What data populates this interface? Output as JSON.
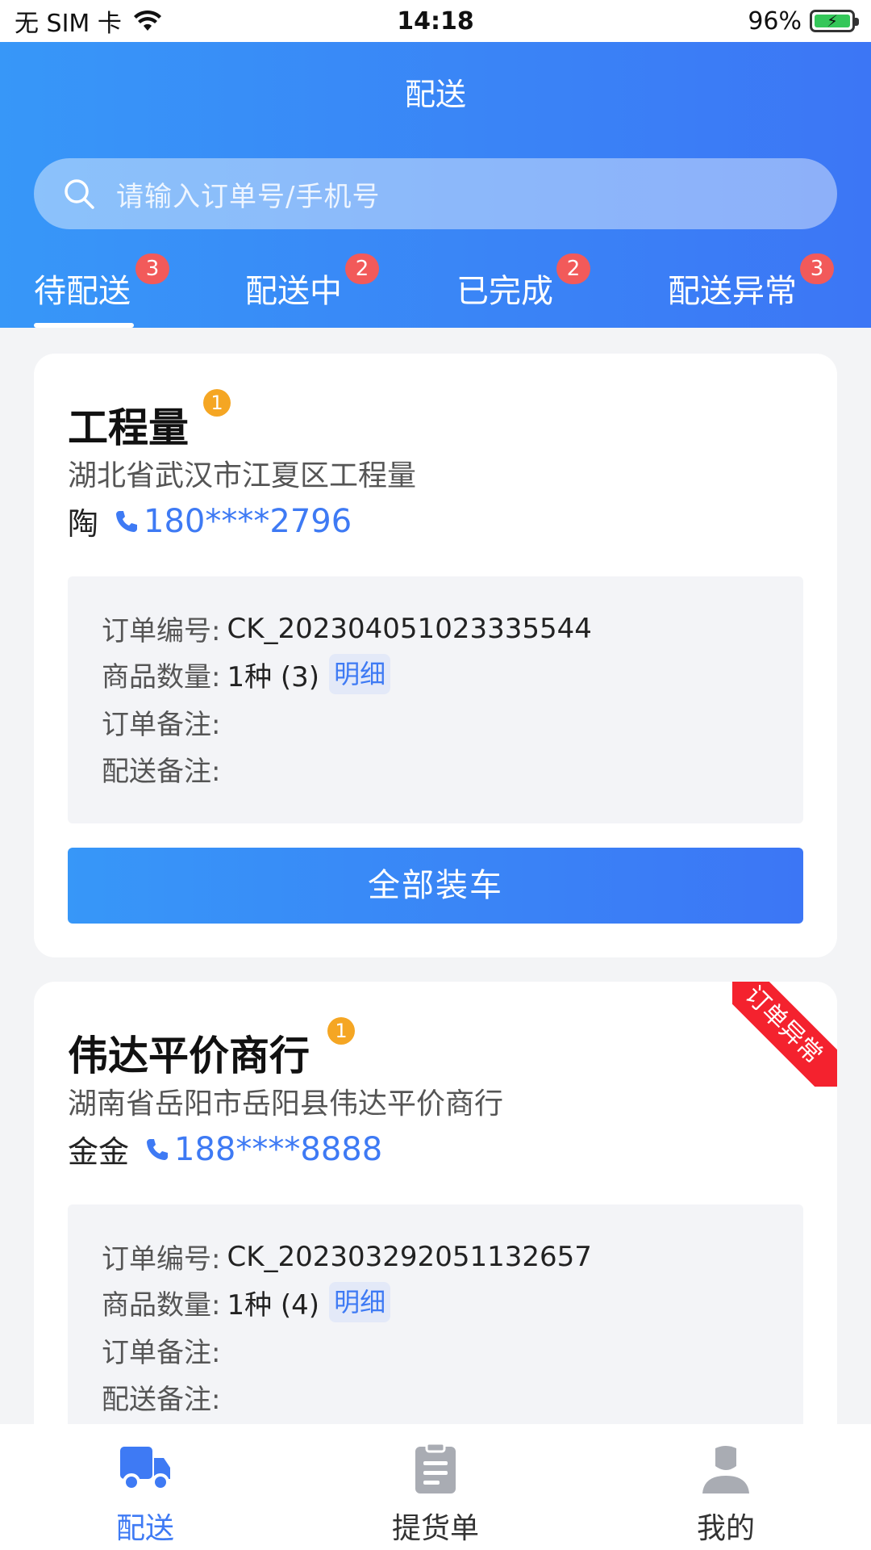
{
  "status_bar": {
    "carrier": "无 SIM 卡",
    "time": "14:18",
    "battery": "96%"
  },
  "header": {
    "title": "配送",
    "search_placeholder": "请输入订单号/手机号"
  },
  "tabs": [
    {
      "label": "待配送",
      "badge": "3"
    },
    {
      "label": "配送中",
      "badge": "2"
    },
    {
      "label": "已完成",
      "badge": "2"
    },
    {
      "label": "配送异常",
      "badge": "3"
    }
  ],
  "orders": [
    {
      "name": "工程量",
      "badge": "1",
      "address": "湖北省武汉市江夏区工程量",
      "contact_name": "陶",
      "phone": "180****2796",
      "order_no_label": "订单编号:",
      "order_no": "CK_202304051023335544",
      "qty_label": "商品数量:",
      "qty": "1种 (3)",
      "detail_label": "明细",
      "order_note_label": "订单备注:",
      "delivery_note_label": "配送备注:",
      "button_label": "全部装车"
    },
    {
      "name": "伟达平价商行",
      "badge": "1",
      "ribbon": "订单异常",
      "address": "湖南省岳阳市岳阳县伟达平价商行",
      "contact_name": "金金",
      "phone": "188****8888",
      "order_no_label": "订单编号:",
      "order_no": "CK_202303292051132657",
      "qty_label": "商品数量:",
      "qty": "1种 (4)",
      "detail_label": "明细",
      "order_note_label": "订单备注:",
      "delivery_note_label": "配送备注:"
    }
  ],
  "bottom_nav": [
    {
      "label": "配送",
      "icon": "truck-icon"
    },
    {
      "label": "提货单",
      "icon": "clipboard-icon"
    },
    {
      "label": "我的",
      "icon": "user-icon"
    }
  ],
  "colors": {
    "primary": "#3c76f5",
    "badge_red": "#f25a5a",
    "badge_orange": "#f5a623",
    "ribbon_red": "#f4222e"
  }
}
